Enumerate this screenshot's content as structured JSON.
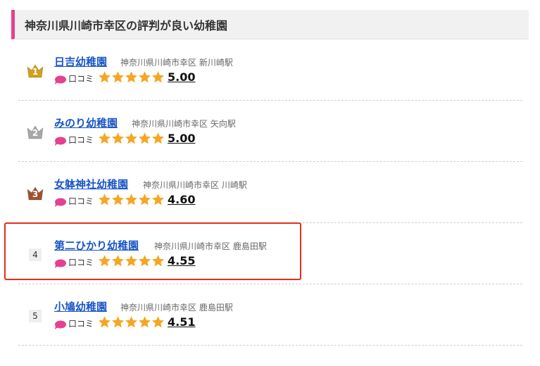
{
  "header": {
    "title": "神奈川県川崎市幸区の評判が良い幼稚園"
  },
  "review_label": "口コミ",
  "items": [
    {
      "rank": "1",
      "medal": "gold",
      "name": "日吉幼稚園",
      "location": "神奈川県川崎市幸区 新川崎駅",
      "rating": 5,
      "score": "5.00"
    },
    {
      "rank": "2",
      "medal": "silver",
      "name": "みのり幼稚園",
      "location": "神奈川県川崎市幸区 矢向駅",
      "rating": 5,
      "score": "5.00"
    },
    {
      "rank": "3",
      "medal": "bronze",
      "name": "女躰神社幼稚園",
      "location": "神奈川県川崎市幸区 川崎駅",
      "rating": 5,
      "score": "4.60"
    },
    {
      "rank": "4",
      "medal": "",
      "name": "第二ひかり幼稚園",
      "location": "神奈川県川崎市幸区 鹿島田駅",
      "rating": 5,
      "score": "4.55"
    },
    {
      "rank": "5",
      "medal": "",
      "name": "小鳩幼稚園",
      "location": "神奈川県川崎市幸区 鹿島田駅",
      "rating": 5,
      "score": "4.51"
    }
  ],
  "colors": {
    "accent": "#e4418f",
    "link": "#1a56c6",
    "star": "#f5a623",
    "highlight": "#e32e1c",
    "gold": "#d4a017",
    "silver": "#a8a8a8",
    "bronze": "#a0522d"
  }
}
